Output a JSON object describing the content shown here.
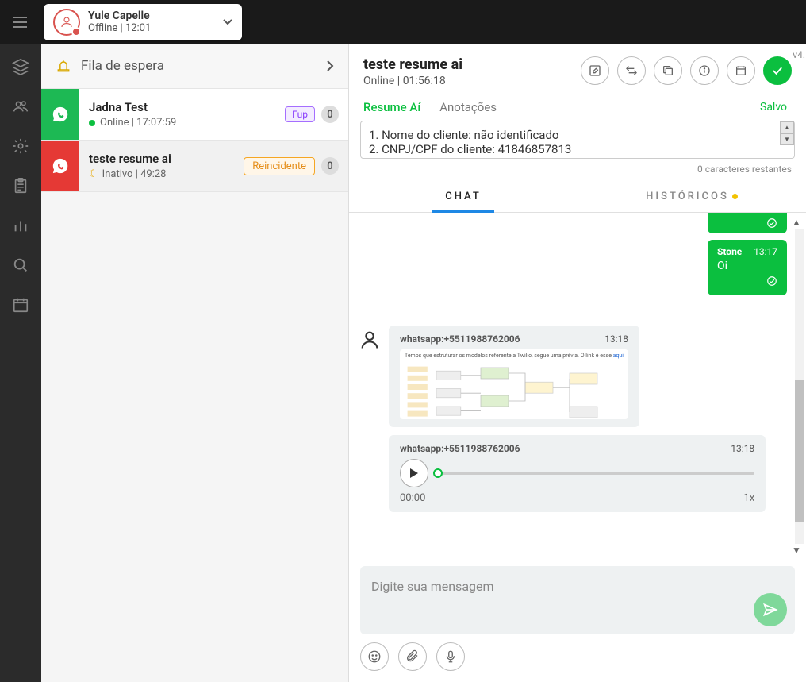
{
  "topbar": {
    "user_name": "Yule Capelle",
    "user_status": "Offline  |  12:01"
  },
  "queue": {
    "title": "Fila de espera"
  },
  "conversations": [
    {
      "name": "Jadna Test",
      "meta": "Online | 17:07:59",
      "badge_label": "Fup",
      "count": "0"
    },
    {
      "name": "teste resume ai",
      "meta": "Inativo | 49:28",
      "badge_label": "Reincidente",
      "count": "0"
    }
  ],
  "chat": {
    "title": "teste resume ai",
    "status": "Online  |  01:56:18",
    "tab_resume": "Resume Aí",
    "tab_annotations": "Anotações",
    "saved_label": "Salvo",
    "summary_line1": "1. Nome do cliente: não identificado",
    "summary_line2": "2. CNPJ/CPF do cliente: 41846857813",
    "chars_remaining": "0 caracteres restantes",
    "tab_chat": "CHAT",
    "tab_history": "HISTÓRICOS"
  },
  "messages": {
    "out1_sender": "Stone",
    "out1_time": "13:17",
    "out1_text": "Oi",
    "in1_sender": "whatsapp:+5511988762006",
    "in1_time": "13:18",
    "in1_caption_a": "Temos que estruturar os modelos referente a Twilio, segue uma prévia. O link é esse ",
    "in1_caption_b": "aqui",
    "in2_sender": "whatsapp:+5511988762006",
    "in2_time": "13:18",
    "audio_pos": "00:00",
    "audio_rate": "1x"
  },
  "composer": {
    "placeholder": "Digite sua mensagem"
  },
  "version": "v4."
}
